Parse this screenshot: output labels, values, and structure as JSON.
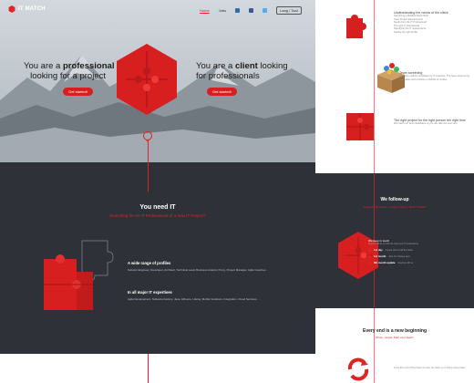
{
  "header": {
    "logo_text": "IT MATCH",
    "nav": [
      "Home",
      "Jobs"
    ],
    "lang_button": "Lang / Taal"
  },
  "hero": {
    "left_line1_prefix": "You are a ",
    "left_line1_bold": "professional",
    "left_line2": "looking for a project",
    "left_button": "Get started!",
    "right_line1_prefix": "You are a ",
    "right_line1_bold": "client",
    "right_line1_suffix": " looking",
    "right_line2": "for professionals",
    "right_button": "Get started!"
  },
  "need": {
    "title": "You need IT",
    "subtitle": "Searching for an IT Professional or a new IT Project?",
    "feature1_title": "A wide range of profiles",
    "feature1_text": "Solution Engineer, Developer, Architect, Technical Lead, Business Analyst, Proxy, Project Manager, Agile Coaches...",
    "feature2_title": "In all major IT expertises",
    "feature2_text": "Agile Development, Software Factory, Java, Alfresco, Liferay, Mobile Solutions, Integration, Cloud Services, ..."
  },
  "right": {
    "s1_title": "Understanding the needs of the client",
    "s1_lines": [
      "Specifying a detailed Match Brief",
      "Clear Project Requirements",
      "Needs from the IT Professional",
      "The right IT professional",
      "Specifying the IT requirements",
      "Getting the right profile"
    ],
    "s2_title": "Team screening",
    "s2_text": "Our team selects candidates by IT expertise. The team screens the candidates and compiles a shortlist of profiles.",
    "s3_title": "The right project for the right person the right time",
    "s3_text": "We match our best candidates so you can take the next step.",
    "follow_title": "We follow-up",
    "follow_sub": "Keeps Professional + Happy Client = Best IT Match",
    "keep_title": "We keep in touch",
    "keep_text": "Regular follow-up with the client and IT professional.",
    "keep_rows": [
      {
        "b": "1st day",
        "t": "A good start is half the battle"
      },
      {
        "b": "1st month",
        "t": "After the hardest days"
      },
      {
        "b": "6th month update",
        "t": "Meeting with us"
      }
    ],
    "every_title": "Every end is a new beginning",
    "every_sub": "Rinse, repeat. Start over again!",
    "last_text": "Once the end of the project is near, we team up to find a new project."
  },
  "colors": {
    "accent": "#e02424",
    "dark": "#2f3138"
  }
}
